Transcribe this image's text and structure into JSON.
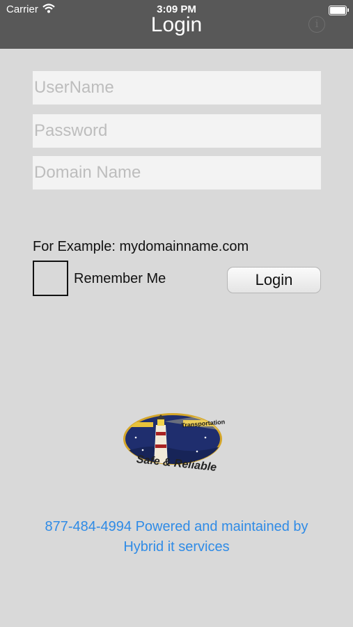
{
  "status_bar": {
    "carrier": "Carrier",
    "time": "3:09 PM",
    "wifi_icon": "wifi-icon",
    "battery_icon": "battery-icon"
  },
  "nav": {
    "title": "Login",
    "info_icon": "info-icon",
    "info_glyph": "i"
  },
  "form": {
    "username_placeholder": "UserName",
    "username_value": "",
    "password_placeholder": "Password",
    "password_value": "",
    "domain_placeholder": "Domain Name",
    "domain_value": "",
    "example_text": "For Example: mydomainname.com",
    "remember_label": "Remember Me",
    "remember_checked": false,
    "login_label": "Login"
  },
  "logo": {
    "banner_text": "Transportation",
    "caption": "Safe & Reliable",
    "colors": {
      "oval": "#1f2e6e",
      "ring": "#d4a62a",
      "banner": "#e8c23a"
    }
  },
  "footer": {
    "line1": "877-484-4994 Powered and maintained by",
    "line2": "Hybrid it services",
    "link_color": "#2f8be6"
  }
}
